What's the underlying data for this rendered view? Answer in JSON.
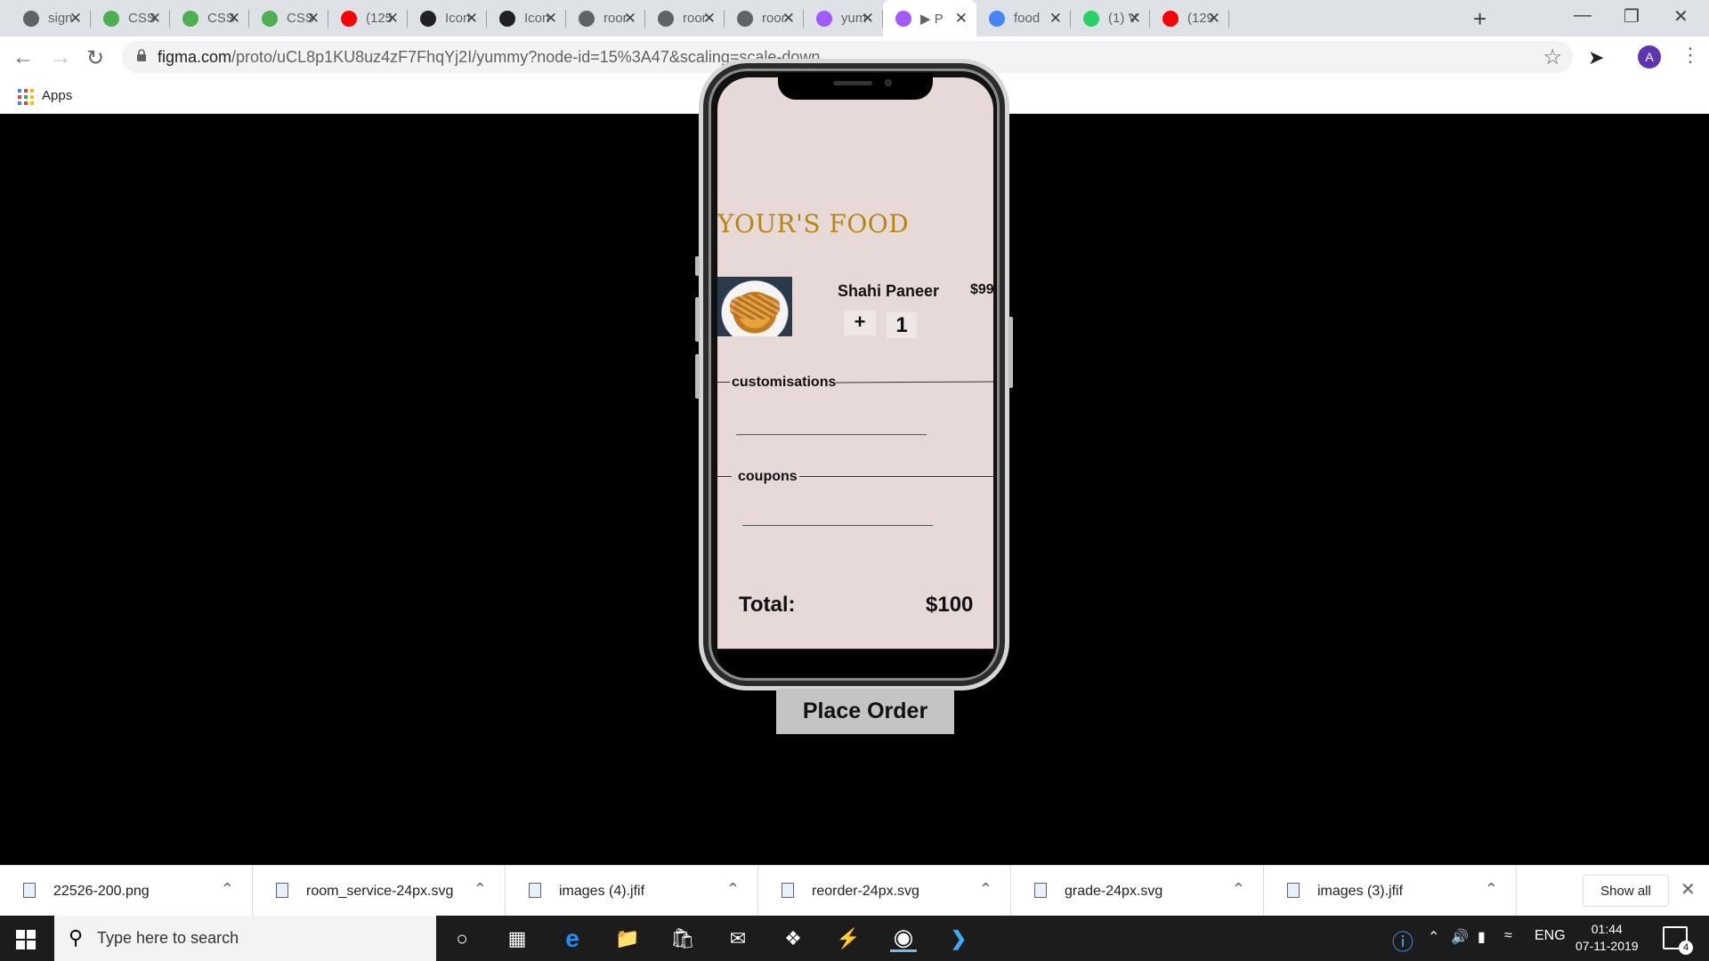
{
  "browser": {
    "tabs": [
      {
        "title": "sign",
        "icon": "globe-icon",
        "color": "#5f6368"
      },
      {
        "title": "CSS",
        "icon": "w3schools-icon",
        "color": "#4caf50"
      },
      {
        "title": "CSS",
        "icon": "w3schools-icon",
        "color": "#4caf50"
      },
      {
        "title": "CSS",
        "icon": "w3schools-icon",
        "color": "#4caf50"
      },
      {
        "title": "(125",
        "icon": "youtube-icon",
        "color": "#ff0000"
      },
      {
        "title": "Icon",
        "icon": "github-icon",
        "color": "#202124"
      },
      {
        "title": "Icon",
        "icon": "github-icon",
        "color": "#202124"
      },
      {
        "title": "roor",
        "icon": "globe-icon",
        "color": "#5f6368"
      },
      {
        "title": "roor",
        "icon": "globe-icon",
        "color": "#5f6368"
      },
      {
        "title": "roor",
        "icon": "globe-icon",
        "color": "#5f6368"
      },
      {
        "title": "yum",
        "icon": "figma-icon",
        "color": "#a259ff"
      },
      {
        "title": "▶ P",
        "icon": "figma-icon",
        "color": "#a259ff",
        "active": true
      },
      {
        "title": "food",
        "icon": "google-icon",
        "color": "#4285f4"
      },
      {
        "title": "(1) V",
        "icon": "whatsapp-icon",
        "color": "#25d366"
      },
      {
        "title": "(129",
        "icon": "youtube-icon",
        "color": "#ff0000"
      }
    ],
    "url_host": "figma.com",
    "url_path": "/proto/uCL8p1KU8uz4zF7FhqYj2I/yummy?node-id=15%3A47&scaling=scale-down",
    "avatar_letter": "A",
    "bookmarks_apps_label": "Apps"
  },
  "app": {
    "title": "YOUR'S FOOD",
    "item": {
      "name": "Shahi Paneer",
      "price": "$99",
      "plus_label": "+",
      "quantity": "1"
    },
    "customisations_label": "customisations",
    "coupons_label": "coupons",
    "total_label": "Total:",
    "total_value": "$100",
    "place_order_label": "Place Order",
    "screen_color": "#e7d9d8",
    "title_color": "#b8860b"
  },
  "downloads": {
    "files": [
      "22526-200.png",
      "room_service-24px.svg",
      "images (4).jfif",
      "reorder-24px.svg",
      "grade-24px.svg",
      "images (3).jfif"
    ],
    "show_all_label": "Show all"
  },
  "taskbar": {
    "search_placeholder": "Type here to search",
    "language": "ENG",
    "time": "01:44",
    "date": "07-11-2019",
    "notification_count": "4"
  }
}
